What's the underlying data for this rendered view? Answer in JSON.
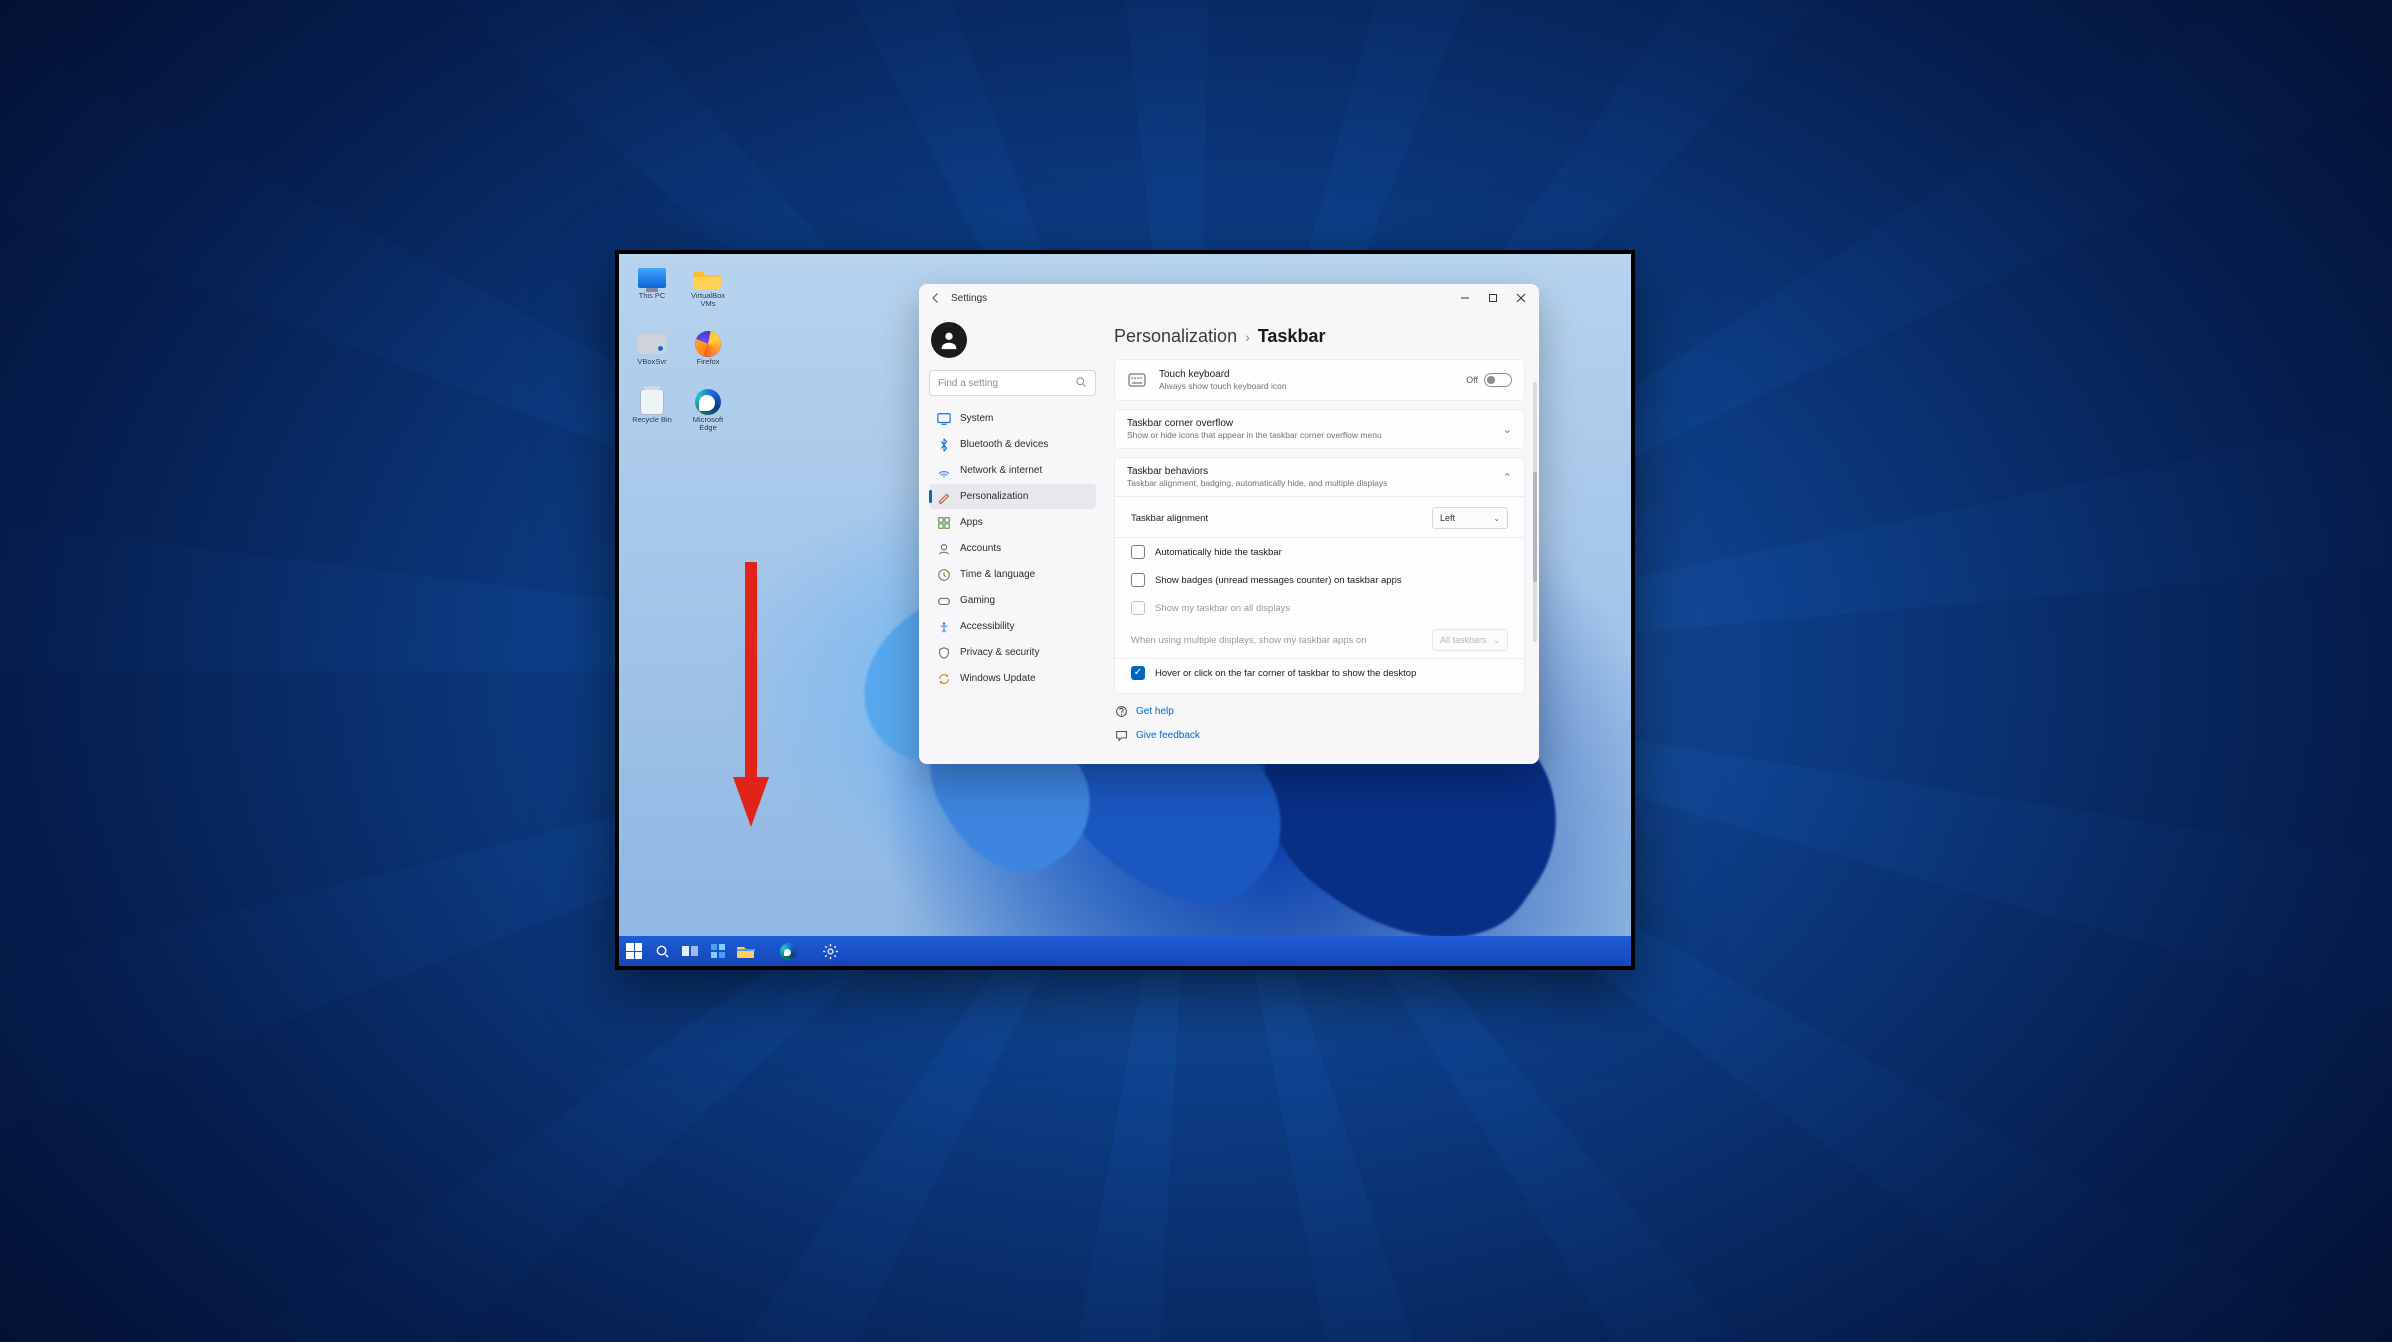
{
  "desktop": {
    "icons": {
      "this_pc": "This PC",
      "virtualbox_vms": "VirtualBox VMs",
      "vboxsvr": "VBoxSvr",
      "firefox": "Firefox",
      "recycle_bin": "Recycle Bin",
      "edge": "Microsoft Edge"
    }
  },
  "settings": {
    "back_aria": "Back",
    "title": "Settings",
    "window_controls": {
      "minimize": "Minimize",
      "maximize": "Maximize",
      "close": "Close"
    },
    "search": {
      "placeholder": "Find a setting"
    },
    "sidebar": {
      "items": [
        {
          "label": "System"
        },
        {
          "label": "Bluetooth & devices"
        },
        {
          "label": "Network & internet"
        },
        {
          "label": "Personalization"
        },
        {
          "label": "Apps"
        },
        {
          "label": "Accounts"
        },
        {
          "label": "Time & language"
        },
        {
          "label": "Gaming"
        },
        {
          "label": "Accessibility"
        },
        {
          "label": "Privacy & security"
        },
        {
          "label": "Windows Update"
        }
      ],
      "selected": 3
    },
    "breadcrumb": {
      "parent": "Personalization",
      "current": "Taskbar"
    },
    "touch_keyboard": {
      "title": "Touch keyboard",
      "subtitle": "Always show touch keyboard icon",
      "toggle_state": "Off"
    },
    "overflow": {
      "title": "Taskbar corner overflow",
      "subtitle": "Show or hide icons that appear in the taskbar corner overflow menu"
    },
    "behaviors": {
      "title": "Taskbar behaviors",
      "subtitle": "Taskbar alignment, badging, automatically hide, and multiple displays",
      "alignment_label": "Taskbar alignment",
      "alignment_value": "Left",
      "auto_hide": "Automatically hide the taskbar",
      "show_badges": "Show badges (unread messages counter) on taskbar apps",
      "show_all_displays": "Show my taskbar on all displays",
      "multi_display_hint": "When using multiple displays, show my taskbar apps on",
      "multi_display_value": "All taskbars",
      "hover_corner": "Hover or click on the far corner of taskbar to show the desktop"
    },
    "links": {
      "get_help": "Get help",
      "give_feedback": "Give feedback"
    }
  }
}
